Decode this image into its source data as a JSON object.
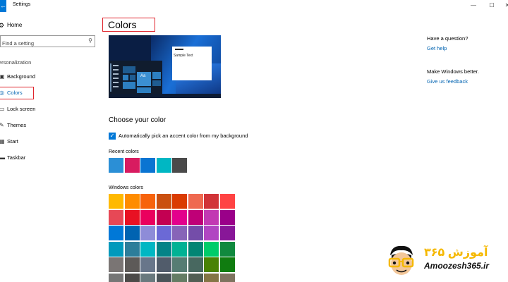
{
  "window": {
    "title": "Settings",
    "back_glyph": "←",
    "controls": {
      "minimize": "—",
      "maximize": "☐",
      "close": "✕"
    }
  },
  "nav": {
    "home_icon": "gear-icon",
    "home_label": "Home",
    "search_placeholder": "Find a setting",
    "group_label": "ersonalization",
    "items": [
      {
        "label": "Background",
        "icon": "picture-icon"
      },
      {
        "label": "Colors",
        "icon": "palette-icon",
        "active": true
      },
      {
        "label": "Lock screen",
        "icon": "monitor-icon"
      },
      {
        "label": "Themes",
        "icon": "brush-icon"
      },
      {
        "label": "Start",
        "icon": "start-icon"
      },
      {
        "label": "Taskbar",
        "icon": "taskbar-icon"
      }
    ]
  },
  "main": {
    "title": "Colors",
    "preview": {
      "sample_text": "Sample Text",
      "tile_text": "Aa"
    },
    "choose_heading": "Choose your color",
    "auto_accent_label": "Automatically pick an accent color from my background",
    "auto_accent_checked": true,
    "recent_label": "Recent colors",
    "recent_colors": [
      "#2b8fd6",
      "#d81b60",
      "#0a74d2",
      "#00b7c3",
      "#4a4a4a"
    ],
    "windows_label": "Windows colors",
    "windows_colors": [
      "#ffb900",
      "#ff8c00",
      "#f7630c",
      "#ca5010",
      "#da3b01",
      "#ef6950",
      "#d13438",
      "#ff4343",
      "#e74856",
      "#e81123",
      "#ea005e",
      "#c30052",
      "#e3008c",
      "#bf0077",
      "#c239b3",
      "#9a0089",
      "#0078d7",
      "#0063b1",
      "#8e8cd8",
      "#6b69d6",
      "#8764b8",
      "#744da9",
      "#b146c2",
      "#881798",
      "#0099bc",
      "#2d7d9a",
      "#00b7c3",
      "#038387",
      "#00b294",
      "#018574",
      "#00cc6a",
      "#10893e",
      "#7a7574",
      "#5d5a58",
      "#68768a",
      "#515c6b",
      "#567c73",
      "#486860",
      "#498205",
      "#107c10",
      "#767676",
      "#4c4a48",
      "#69797e",
      "#4a5459",
      "#647c64",
      "#525e54",
      "#847545",
      "#7e735f"
    ]
  },
  "help": {
    "question_heading": "Have a question?",
    "question_link": "Get help",
    "better_heading": "Make Windows better.",
    "better_link": "Give us feedback"
  },
  "watermark": {
    "persian_text": "آموزش ۳۶۵",
    "url": "Amoozesh365.ir"
  },
  "colors": {
    "accent": "#0078d7",
    "link": "#0063b1",
    "annotation": "#e0252d"
  }
}
